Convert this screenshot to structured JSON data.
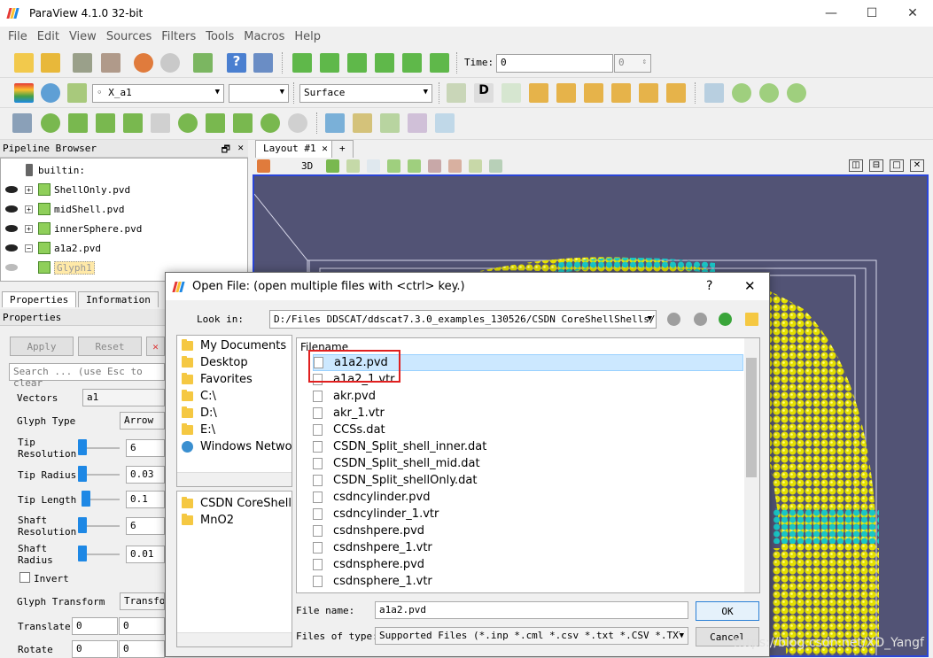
{
  "app": {
    "title": "ParaView 4.1.0 32-bit"
  },
  "window_controls": {
    "minimize": "—",
    "maximize": "☐",
    "close": "✕"
  },
  "menu": [
    "File",
    "Edit",
    "View",
    "Sources",
    "Filters",
    "Tools",
    "Macros",
    "Help"
  ],
  "toolbar1": {
    "time_label": "Time:",
    "time_value": "0",
    "time_index": "0"
  },
  "toolbar2": {
    "array_combo": "X_a1",
    "representation": "Surface"
  },
  "pipeline": {
    "header": "Pipeline Browser",
    "items": [
      {
        "label": "builtin:"
      },
      {
        "label": "ShellOnly.pvd"
      },
      {
        "label": "midShell.pvd"
      },
      {
        "label": "innerSphere.pvd"
      },
      {
        "label": "a1a2.pvd"
      },
      {
        "label": "Glyph1"
      }
    ]
  },
  "properties": {
    "tabs": [
      "Properties",
      "Information"
    ],
    "header": "Properties",
    "apply": "Apply",
    "reset": "Reset",
    "search_placeholder": "Search ... (use Esc to clear",
    "fields": {
      "vectors_label": "Vectors",
      "vectors_value": "a1",
      "glyph_type_label": "Glyph Type",
      "glyph_type_value": "Arrow",
      "tip_resolution_label": "Tip Resolution",
      "tip_resolution_value": "6",
      "tip_radius_label": "Tip Radius",
      "tip_radius_value": "0.03",
      "tip_length_label": "Tip Length",
      "tip_length_value": "0.1",
      "shaft_resolution_label": "Shaft Resolution",
      "shaft_resolution_value": "6",
      "shaft_radius_label": "Shaft Radius",
      "shaft_radius_value": "0.01",
      "invert_label": "Invert",
      "glyph_transform_label": "Glyph Transform",
      "glyph_transform_value": "Transform",
      "translate_label": "Translate",
      "translate_x": "0",
      "translate_y": "0",
      "rotate_label": "Rotate",
      "rotate_x": "0",
      "rotate_y": "0"
    }
  },
  "layout": {
    "tab": "Layout #1",
    "add_tab": "+",
    "view_3d": "3D"
  },
  "dialog": {
    "title": "Open File:  (open multiple files with <ctrl> key.)",
    "help": "?",
    "close": "✕",
    "look_in_label": "Look in:",
    "look_in_value": "D:/Files DDSCAT/ddscat7.3.0_examples_130526/CSDN CoreShellShells/",
    "places": [
      "My Documents",
      "Desktop",
      "Favorites",
      "C:\\",
      "D:\\",
      "E:\\",
      "Windows Network"
    ],
    "recent": [
      "CSDN CoreShellShells",
      "MnO2"
    ],
    "filename_header": "Filename",
    "files": [
      "a1a2.pvd",
      "a1a2_1.vtr",
      "akr.pvd",
      "akr_1.vtr",
      "CCSs.dat",
      "CSDN_Split_shell_inner.dat",
      "CSDN_Split_shell_mid.dat",
      "CSDN_Split_shellOnly.dat",
      "csdncylinder.pvd",
      "csdncylinder_1.vtr",
      "csdnshpere.pvd",
      "csdnshpere_1.vtr",
      "csdnsphere.pvd",
      "csdnsphere_1.vtr"
    ],
    "selected_index": 0,
    "file_name_label": "File name:",
    "file_name_value": "a1a2.pvd",
    "file_type_label": "Files of type:",
    "file_type_value": "Supported Files (*.inp  *.cml  *.csv *.txt *.CSV *.TXT",
    "ok": "OK",
    "cancel": "Cancel"
  },
  "watermark": "https://blog.csdn.net/XD_Yangf",
  "colors": {
    "accent": "#2a45d8",
    "selection": "#cce8ff",
    "highlight_box": "#e02020",
    "render_bg": "#525375"
  }
}
